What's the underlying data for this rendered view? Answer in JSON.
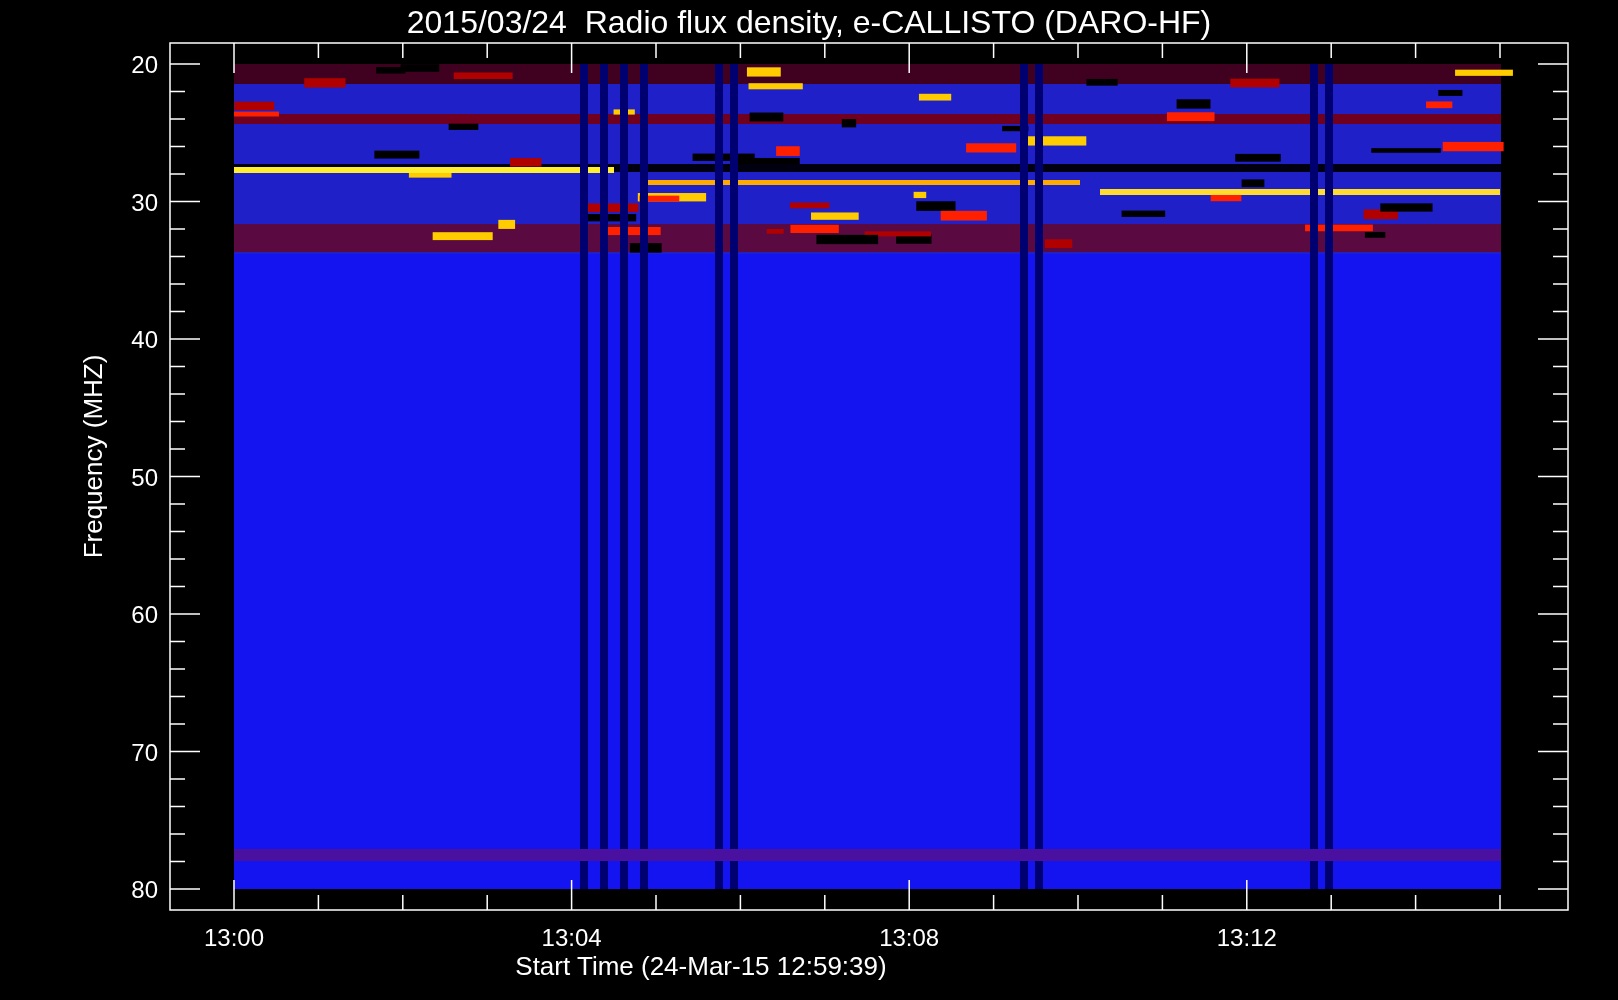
{
  "title": "2015/03/24  Radio flux density, e-CALLISTO (DARO-HF)",
  "x_axis": {
    "label": "Start Time (24-Mar-15 12:59:39)",
    "ticks": [
      "13:00",
      "13:04",
      "13:08",
      "13:12"
    ]
  },
  "y_axis": {
    "label": "Frequency (MHZ)",
    "ticks": [
      "20",
      "30",
      "40",
      "50",
      "60",
      "70",
      "80"
    ]
  }
}
